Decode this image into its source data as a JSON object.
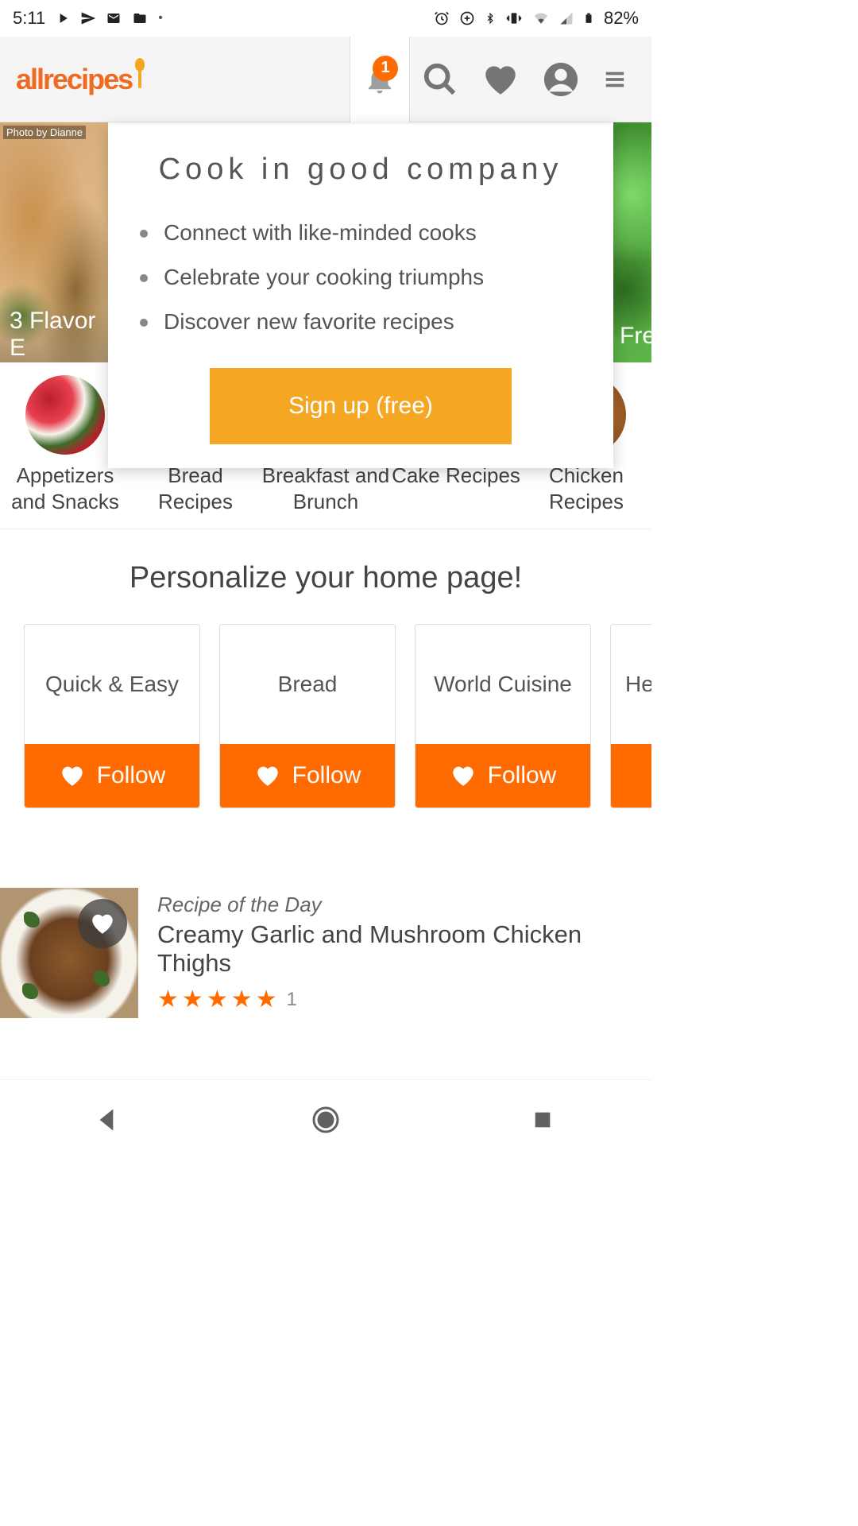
{
  "status_bar": {
    "time": "5:11",
    "battery": "82%"
  },
  "header": {
    "logo": "allrecipes",
    "notification_count": "1"
  },
  "popup": {
    "title": "Cook in good company",
    "bullets": [
      "Connect with like-minded cooks",
      "Celebrate your cooking triumphs",
      "Discover new favorite recipes"
    ],
    "cta": "Sign up (free)"
  },
  "hero": {
    "left_label": "3 Flavor E",
    "left_credit": "Photo by Dianne",
    "right_label": "Fre"
  },
  "categories": [
    "Appetizers and Snacks",
    "Bread Recipes",
    "Breakfast and Brunch",
    "Cake Recipes",
    "Chicken Recipes"
  ],
  "personalize": {
    "title": "Personalize your home page!",
    "follow_label": "Follow",
    "cards": [
      "Quick & Easy",
      "Bread",
      "World Cuisine",
      "Hea"
    ]
  },
  "recipe_of_day": {
    "label": "Recipe of the Day",
    "title": "Creamy Garlic and Mushroom Chicken Thighs",
    "rating_count": "1"
  }
}
